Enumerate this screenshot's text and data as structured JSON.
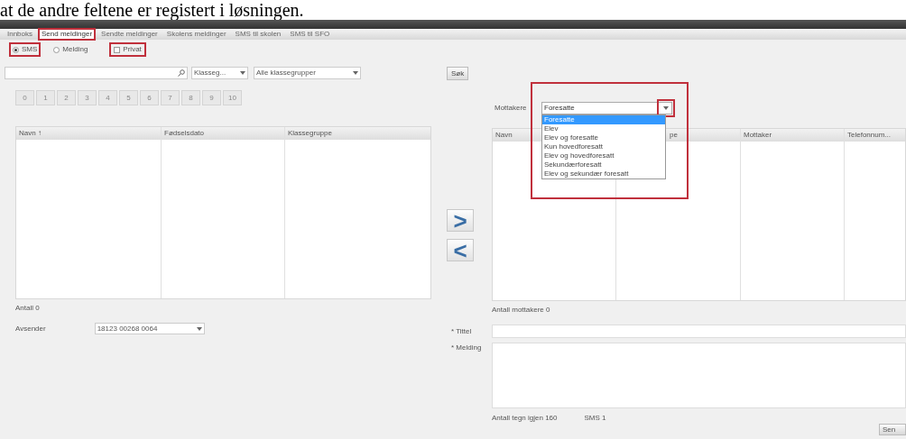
{
  "document_text": "at de andre feltene er registert i løsningen.",
  "tabs": [
    {
      "label": "Innboks",
      "selected": false,
      "highlighted": false
    },
    {
      "label": "Send meldinger",
      "selected": true,
      "highlighted": true
    },
    {
      "label": "Sendte meldinger",
      "selected": false,
      "highlighted": false
    },
    {
      "label": "Skolens meldinger",
      "selected": false,
      "highlighted": false
    },
    {
      "label": "SMS til skolen",
      "selected": false,
      "highlighted": false
    },
    {
      "label": "SMS til SFO",
      "selected": false,
      "highlighted": false
    }
  ],
  "message_types": [
    {
      "label": "SMS",
      "selected": true,
      "highlighted": true
    },
    {
      "label": "Melding",
      "selected": false,
      "highlighted": false
    }
  ],
  "private": {
    "label": "Privat",
    "checked": false,
    "highlighted": true
  },
  "search": {
    "class_select": "Klasseg...",
    "group_select": "Alle klassegrupper",
    "search_button": "Søk"
  },
  "letters": [
    "0",
    "1",
    "2",
    "3",
    "4",
    "5",
    "6",
    "7",
    "8",
    "9",
    "10"
  ],
  "left_table": {
    "columns": [
      "Navn ↑",
      "Fødselsdato",
      "Klassegruppe"
    ],
    "count": "Antall 0"
  },
  "sender": {
    "label": "Avsender",
    "value": "18123 00268 0064"
  },
  "move_buttons": [
    ">",
    "<"
  ],
  "recipients": {
    "label": "Mottakere",
    "value": "Foresatte",
    "highlighted": true,
    "options": [
      {
        "label": "Foresatte",
        "selected": true
      },
      {
        "label": "Elev",
        "selected": false
      },
      {
        "label": "Elev og foresatte",
        "selected": false
      },
      {
        "label": "Kun hovedforesatt",
        "selected": false
      },
      {
        "label": "Elev og hovedforesatt",
        "selected": false
      },
      {
        "label": "Sekundærforesatt",
        "selected": false
      },
      {
        "label": "Elev og sekundær foresatt",
        "selected": false
      }
    ]
  },
  "right_table": {
    "columns": [
      "Navn",
      "pe",
      "Mottaker",
      "Telefonnum..."
    ],
    "count": "Antall mottakere 0"
  },
  "form": {
    "title_label": "* Tittel",
    "message_label": "* Melding",
    "chars_left": "Antall tegn igjen 160",
    "sms_count": "SMS 1",
    "send_button": "Sen"
  }
}
